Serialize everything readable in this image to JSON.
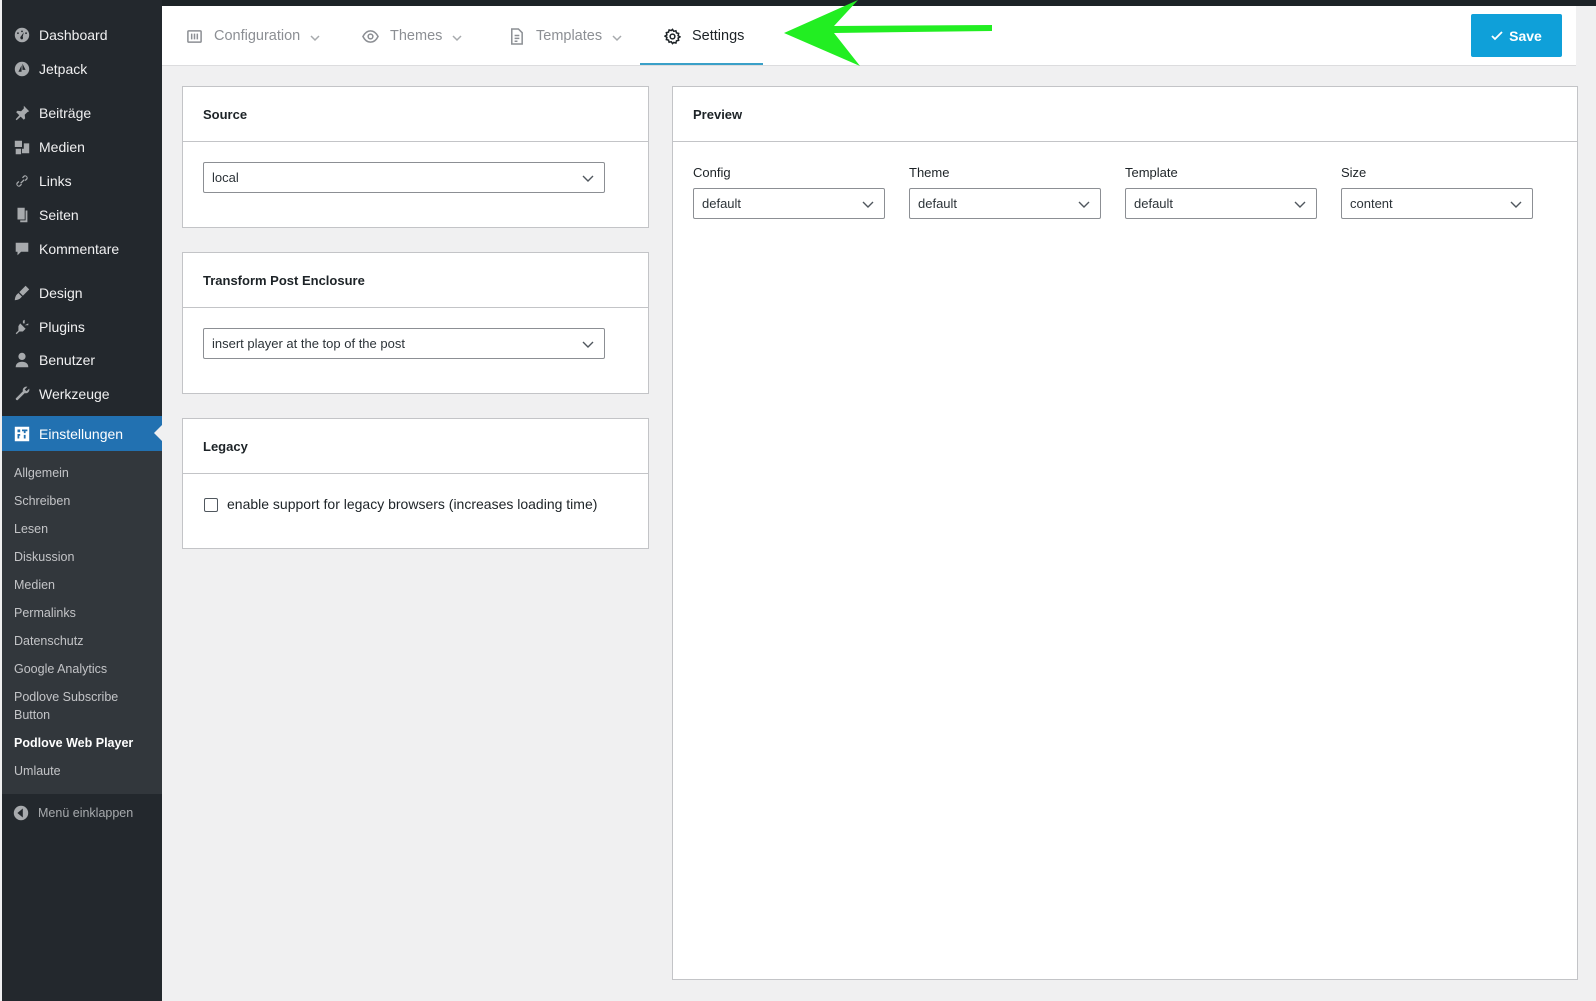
{
  "sidebar": {
    "items": [
      {
        "label": "Dashboard",
        "icon": "dashboard-icon"
      },
      {
        "label": "Jetpack",
        "icon": "jetpack-icon"
      },
      {
        "label": "Beiträge",
        "icon": "pin-icon"
      },
      {
        "label": "Medien",
        "icon": "media-icon"
      },
      {
        "label": "Links",
        "icon": "link-icon"
      },
      {
        "label": "Seiten",
        "icon": "page-icon"
      },
      {
        "label": "Kommentare",
        "icon": "comment-icon"
      },
      {
        "label": "Design",
        "icon": "brush-icon"
      },
      {
        "label": "Plugins",
        "icon": "plugin-icon"
      },
      {
        "label": "Benutzer",
        "icon": "user-icon"
      },
      {
        "label": "Werkzeuge",
        "icon": "wrench-icon"
      },
      {
        "label": "Einstellungen",
        "icon": "settings-icon"
      }
    ],
    "submenu": [
      "Allgemein",
      "Schreiben",
      "Lesen",
      "Diskussion",
      "Medien",
      "Permalinks",
      "Datenschutz",
      "Google Analytics",
      "Podlove Subscribe Button",
      "Podlove Web Player",
      "Umlaute"
    ],
    "collapse_label": "Menü einklappen"
  },
  "tabs": [
    {
      "label": "Configuration",
      "icon": "configuration-icon"
    },
    {
      "label": "Themes",
      "icon": "eye-icon"
    },
    {
      "label": "Templates",
      "icon": "document-icon"
    },
    {
      "label": "Settings",
      "icon": "gear-icon"
    }
  ],
  "save_label": "Save",
  "source": {
    "title": "Source",
    "value": "local"
  },
  "transform": {
    "title": "Transform Post Enclosure",
    "value": "insert player at the top of the post"
  },
  "legacy": {
    "title": "Legacy",
    "checkbox_label": "enable support for legacy browsers (increases loading time)",
    "checked": false
  },
  "preview": {
    "title": "Preview",
    "fields": [
      {
        "label": "Config",
        "value": "default"
      },
      {
        "label": "Theme",
        "value": "default"
      },
      {
        "label": "Template",
        "value": "default"
      },
      {
        "label": "Size",
        "value": "content"
      }
    ]
  },
  "colors": {
    "accent": "#0fa0d9",
    "active_menu": "#2271b1",
    "annotation_arrow": "#22ee22"
  }
}
